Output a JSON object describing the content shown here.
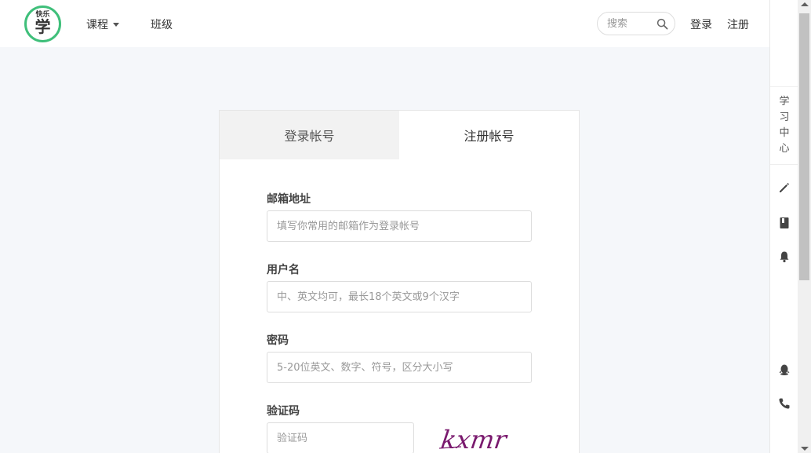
{
  "header": {
    "logo_small": "快乐",
    "logo_big": "学",
    "nav": [
      {
        "label": "课程",
        "has_dropdown": true
      },
      {
        "label": "班级",
        "has_dropdown": false
      }
    ],
    "search_placeholder": "搜索",
    "login": "登录",
    "register": "注册"
  },
  "sidebar": {
    "study_center": [
      "学",
      "习",
      "中",
      "心"
    ],
    "icons": [
      "pencil-icon",
      "book-icon",
      "bell-icon",
      "qq-icon",
      "phone-icon"
    ]
  },
  "card": {
    "tabs": [
      {
        "label": "登录帐号",
        "active": false
      },
      {
        "label": "注册帐号",
        "active": true
      }
    ],
    "fields": {
      "email": {
        "label": "邮箱地址",
        "placeholder": "填写你常用的邮箱作为登录帐号"
      },
      "username": {
        "label": "用户名",
        "placeholder": "中、英文均可，最长18个英文或9个汉字"
      },
      "password": {
        "label": "密码",
        "placeholder": "5-20位英文、数字、符号，区分大小写"
      },
      "captcha": {
        "label": "验证码",
        "placeholder": "验证码",
        "image_text": "kxmr"
      }
    }
  },
  "colors": {
    "accent": "#3fbf7a",
    "captcha": "#7a1a6e"
  }
}
